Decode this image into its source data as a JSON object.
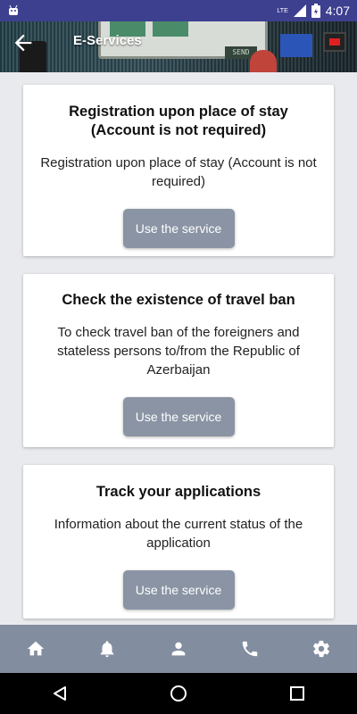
{
  "status_bar": {
    "time": "4:07",
    "network": "LTE",
    "icons": [
      "android-icon",
      "signal-icon",
      "battery-icon"
    ]
  },
  "header": {
    "title": "E-Services",
    "back_icon": "arrow-back-icon",
    "banner_send_text": "SEND"
  },
  "services": [
    {
      "title": "Registration upon place of stay (Account is not required)",
      "description": "Registration upon place of stay (Account is not required)",
      "button_label": "Use the service"
    },
    {
      "title": "Check the existence of travel ban",
      "description": "To check travel ban of the foreigners and stateless persons to/from the Republic of Azerbaijan",
      "button_label": "Use the service"
    },
    {
      "title": "Track your applications",
      "description": "Information about the current status of the application",
      "button_label": "Use the service"
    }
  ],
  "bottom_nav": [
    "home-icon",
    "bell-icon",
    "person-icon",
    "phone-icon",
    "settings-icon"
  ],
  "system_nav": [
    "back-triangle-icon",
    "home-circle-icon",
    "recents-square-icon"
  ],
  "colors": {
    "status_bar": "#3d3f8f",
    "button": "#8a94a4",
    "bottom_nav": "#838da0",
    "background": "#e9eaed"
  }
}
